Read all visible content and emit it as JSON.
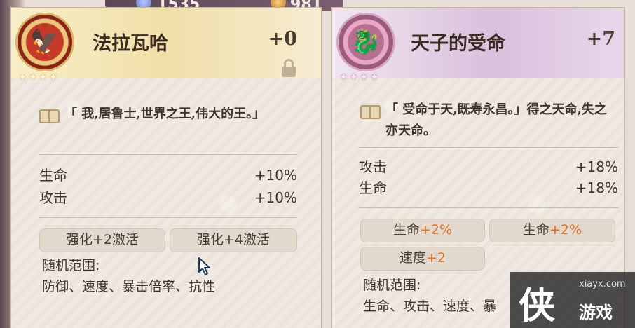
{
  "top": {
    "left_count": "1535",
    "right_count": "981"
  },
  "cards": [
    {
      "name": "法拉瓦哈",
      "level": "+0",
      "stars": 4,
      "quote": "「 我,居鲁士,世界之王,伟大的王。」",
      "stats": [
        {
          "label": "生命",
          "value": "+10%"
        },
        {
          "label": "攻击",
          "value": "+10%"
        }
      ],
      "chips": [
        {
          "text": "强化+2激活"
        },
        {
          "text": "强化+4激活"
        }
      ],
      "random_label": "随机范围:",
      "random_values": "防御、速度、暴击倍率、抗性"
    },
    {
      "name": "天子的受命",
      "level": "+7",
      "stars": 4,
      "quote": "「 受命于天,既寿永昌。」得之天命,失之亦天命。",
      "stats": [
        {
          "label": "攻击",
          "value": "+18%"
        },
        {
          "label": "生命",
          "value": "+18%"
        }
      ],
      "chips": [
        {
          "label": "生命",
          "value": "+2%"
        },
        {
          "label": "生命",
          "value": "+2%"
        },
        {
          "label": "速度",
          "value": "+2"
        }
      ],
      "random_label": "随机范围:",
      "random_values": "生命、攻击、速度、暴"
    }
  ],
  "watermark": {
    "brand": "游戏",
    "site": "xiayx.com",
    "logo": "侠"
  },
  "colors": {
    "accent_orange": "#e1742a",
    "gold_header": "#f1dfa8",
    "purple_header": "#d9c0dd"
  }
}
